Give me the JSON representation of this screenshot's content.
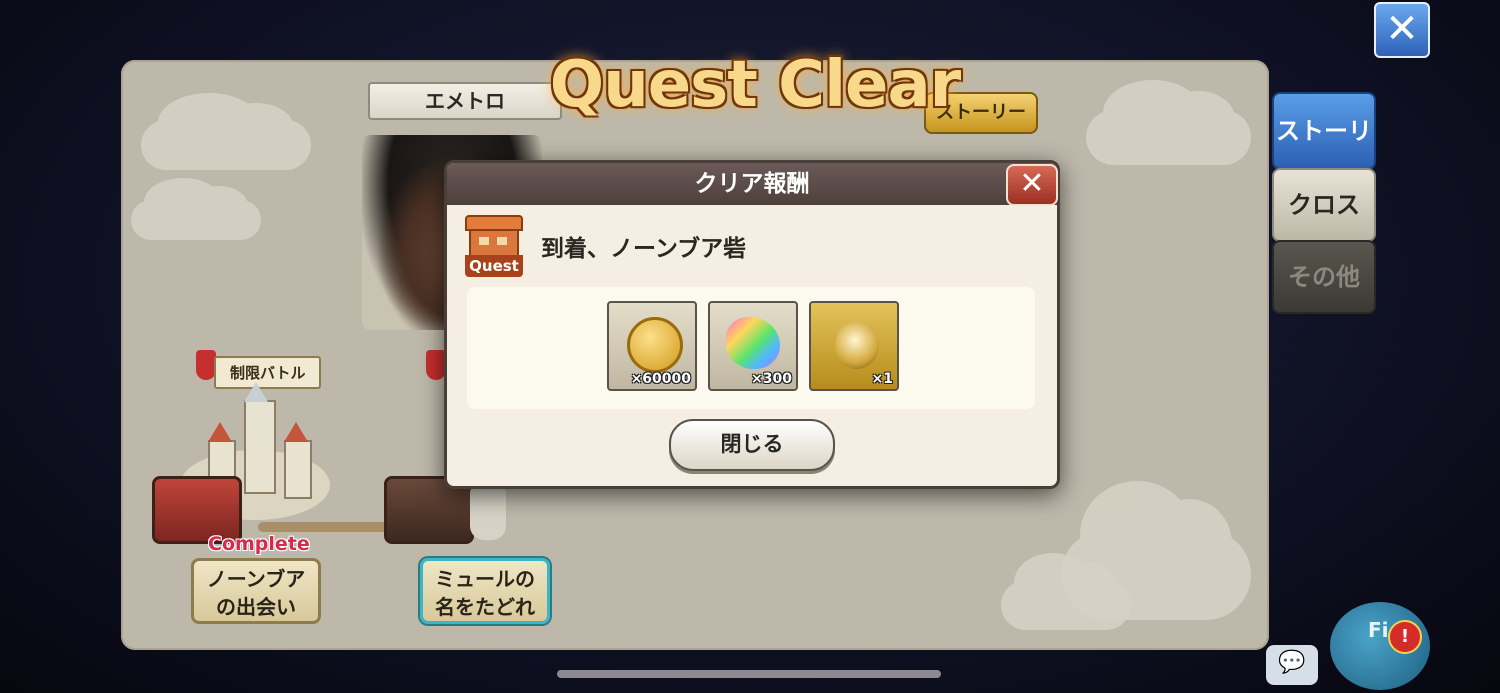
{
  "header": {
    "quest_clear_title": "Quest Clear",
    "region_label": "エメトロ",
    "story_tab_gold": "ストーリー",
    "close_symbol": "✕"
  },
  "side_tabs": [
    {
      "label": "ストーリー",
      "active": true
    },
    {
      "label": "クロス",
      "active": false
    },
    {
      "label": "その他",
      "active": false
    }
  ],
  "map": {
    "restricted_battle_banner": "制限バトル",
    "complete_badge": "Complete",
    "nodes": [
      {
        "label_line1": "ノーンブア",
        "label_line2": "の出会い",
        "complete": true
      },
      {
        "label_line1": "ミュールの",
        "label_line2": "名をたどれ",
        "selected": true
      }
    ]
  },
  "modal": {
    "title": "クリア報酬",
    "close_symbol": "✕",
    "quest_icon_label": "Quest",
    "quest_name": "到着、ノーンブア砦",
    "rewards": [
      {
        "icon": "gold-coin-icon",
        "quantity": "×60000"
      },
      {
        "icon": "rainbow-gem-icon",
        "quantity": "×300"
      },
      {
        "icon": "gold-pendant-icon",
        "quantity": "×1"
      }
    ],
    "close_button_label": "閉じる"
  },
  "bottom": {
    "chat_icon": "💬",
    "field_label": "Fi d",
    "alert_symbol": "!"
  },
  "colors": {
    "accent_blue": "#2c5fb3",
    "gold": "#c6941e",
    "complete_red": "#d82a4e",
    "modal_header": "#4e403d"
  }
}
